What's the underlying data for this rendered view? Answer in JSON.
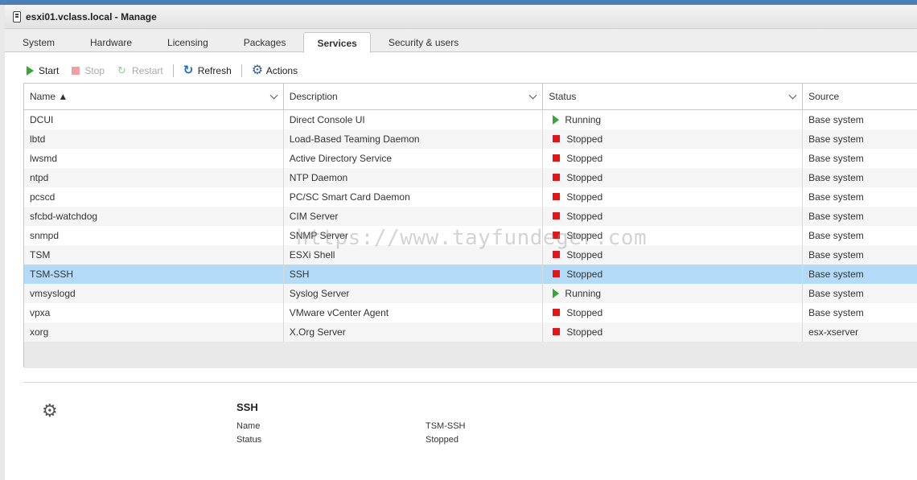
{
  "window": {
    "title": "esxi01.vclass.local - Manage"
  },
  "tabs": [
    {
      "label": "System"
    },
    {
      "label": "Hardware"
    },
    {
      "label": "Licensing"
    },
    {
      "label": "Packages"
    },
    {
      "label": "Services",
      "active": true
    },
    {
      "label": "Security & users"
    }
  ],
  "toolbar": {
    "start": "Start",
    "stop": "Stop",
    "restart": "Restart",
    "refresh": "Refresh",
    "actions": "Actions"
  },
  "table": {
    "columns": [
      "Name ▲",
      "Description",
      "Status",
      "Source"
    ],
    "rows": [
      {
        "name": "DCUI",
        "description": "Direct Console UI",
        "status": "Running",
        "source": "Base system"
      },
      {
        "name": "lbtd",
        "description": "Load-Based Teaming Daemon",
        "status": "Stopped",
        "source": "Base system"
      },
      {
        "name": "lwsmd",
        "description": "Active Directory Service",
        "status": "Stopped",
        "source": "Base system"
      },
      {
        "name": "ntpd",
        "description": "NTP Daemon",
        "status": "Stopped",
        "source": "Base system"
      },
      {
        "name": "pcscd",
        "description": "PC/SC Smart Card Daemon",
        "status": "Stopped",
        "source": "Base system"
      },
      {
        "name": "sfcbd-watchdog",
        "description": "CIM Server",
        "status": "Stopped",
        "source": "Base system"
      },
      {
        "name": "snmpd",
        "description": "SNMP Server",
        "status": "Stopped",
        "source": "Base system"
      },
      {
        "name": "TSM",
        "description": "ESXi Shell",
        "status": "Stopped",
        "source": "Base system"
      },
      {
        "name": "TSM-SSH",
        "description": "SSH",
        "status": "Stopped",
        "source": "Base system",
        "selected": true
      },
      {
        "name": "vmsyslogd",
        "description": "Syslog Server",
        "status": "Running",
        "source": "Base system"
      },
      {
        "name": "vpxa",
        "description": "VMware vCenter Agent",
        "status": "Stopped",
        "source": "Base system"
      },
      {
        "name": "xorg",
        "description": "X.Org Server",
        "status": "Stopped",
        "source": "esx-xserver"
      }
    ]
  },
  "details": {
    "title": "SSH",
    "name_label": "Name",
    "name_value": "TSM-SSH",
    "status_label": "Status",
    "status_value": "Stopped"
  },
  "watermark": "https://www.tayfundeger.com",
  "colors": {
    "running": "#3aa53a",
    "stopped": "#e21616",
    "selected_row": "#b3dbf7",
    "accent": "#1a6cc8"
  }
}
